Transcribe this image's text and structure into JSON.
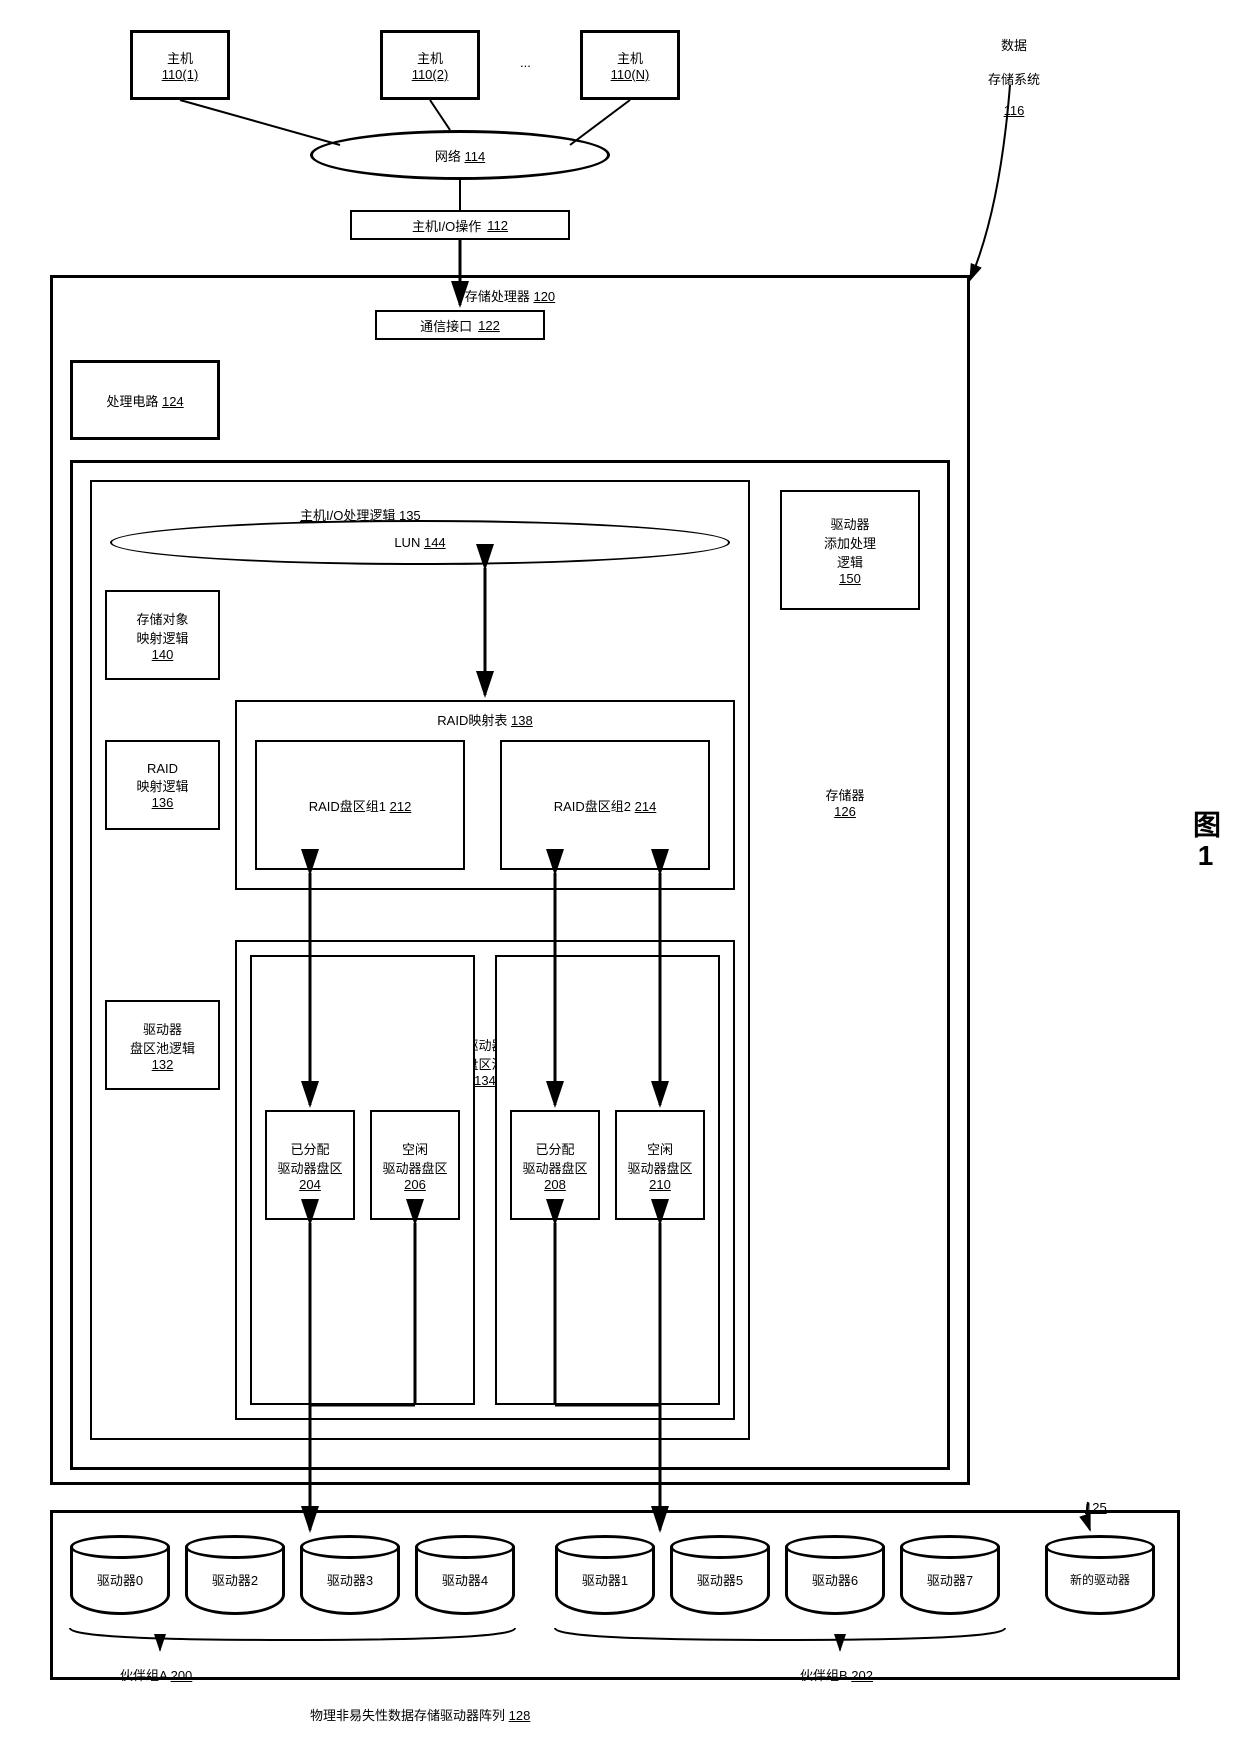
{
  "title": {
    "l1": "数据",
    "l2": "存储系统",
    "ref": "116"
  },
  "hosts": {
    "h1": {
      "name": "主机",
      "ref": "110(1)"
    },
    "h2": {
      "name": "主机",
      "ref": "110(2)"
    },
    "hn": {
      "name": "主机",
      "ref": "110(N)"
    },
    "dots": "..."
  },
  "network": {
    "name": "网络",
    "ref": "114"
  },
  "host_io_ops": {
    "name": "主机I/O操作",
    "ref": "112"
  },
  "sp": {
    "name": "存储处理器",
    "ref": "120"
  },
  "comm_if": {
    "name": "通信接口",
    "ref": "122"
  },
  "proc_circ": {
    "name": "处理电路",
    "ref": "124"
  },
  "memory": {
    "name": "存储器",
    "ref": "126"
  },
  "drv_add": {
    "l1": "驱动器",
    "l2": "添加处理",
    "l3": "逻辑",
    "ref": "150"
  },
  "host_io_logic": {
    "name": "主机I/O处理逻辑",
    "ref": "135"
  },
  "lun": {
    "name": "LUN",
    "ref": "144"
  },
  "storage_obj_map": {
    "l1": "存储对象",
    "l2": "映射逻辑",
    "ref": "140"
  },
  "raid_map_logic": {
    "l1": "RAID",
    "l2": "映射逻辑",
    "ref": "136"
  },
  "raid_map_table": {
    "name": "RAID映射表",
    "ref": "138"
  },
  "raid_eg1": {
    "name": "RAID盘区组1",
    "ref": "212"
  },
  "raid_eg2": {
    "name": "RAID盘区组2",
    "ref": "214"
  },
  "drv_pool_logic": {
    "l1": "驱动器",
    "l2": "盘区池逻辑",
    "ref": "132"
  },
  "drv_pool": {
    "l1": "驱动器",
    "l2": "盘区池",
    "ref": "134"
  },
  "alloc1": {
    "l1": "已分配",
    "l2": "驱动器盘区",
    "ref": "204"
  },
  "free1": {
    "l1": "空闲",
    "l2": "驱动器盘区",
    "ref": "206"
  },
  "alloc2": {
    "l1": "已分配",
    "l2": "驱动器盘区",
    "ref": "208"
  },
  "free2": {
    "l1": "空闲",
    "l2": "驱动器盘区",
    "ref": "210"
  },
  "drives": {
    "d0": "驱动器0",
    "d1": "驱动器1",
    "d2": "驱动器2",
    "d3": "驱动器3",
    "d4": "驱动器4",
    "d5": "驱动器5",
    "d6": "驱动器6",
    "d7": "驱动器7",
    "new": "新的驱动器"
  },
  "new_drive_ref": "125",
  "partner_a": {
    "name": "伙伴组A",
    "ref": "200"
  },
  "partner_b": {
    "name": "伙伴组B",
    "ref": "202"
  },
  "drive_array": {
    "name": "物理非易失性数据存储驱动器阵列",
    "ref": "128"
  },
  "fig": "图1"
}
